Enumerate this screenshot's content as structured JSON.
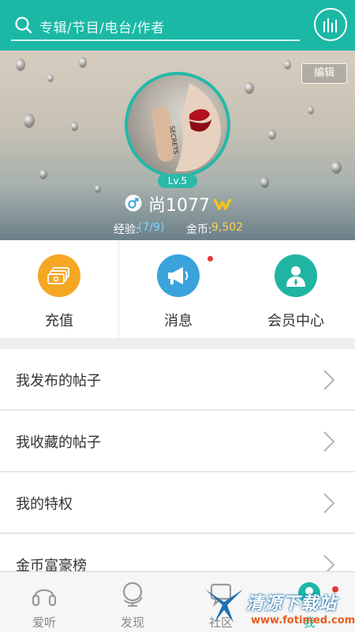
{
  "search": {
    "placeholder": "专辑/节目/电台/作者"
  },
  "profile": {
    "edit_label": "编辑",
    "level": "Lv.5",
    "username": "尚1077",
    "exp_label": "经验:",
    "exp_value": "(7/9)",
    "coin_label": "金币:",
    "coin_value": "9,502"
  },
  "quick_actions": [
    {
      "label": "充值",
      "icon": "wallet-icon",
      "color": "#f5a623"
    },
    {
      "label": "消息",
      "icon": "megaphone-icon",
      "color": "#3aa3dc",
      "has_dot": true
    },
    {
      "label": "会员中心",
      "icon": "member-person-icon",
      "color": "#20b5a3"
    }
  ],
  "menu": [
    {
      "label": "我发布的帖子"
    },
    {
      "label": "我收藏的帖子"
    },
    {
      "label": "我的特权"
    },
    {
      "label": "金币富豪榜"
    }
  ],
  "bottom_nav": [
    {
      "label": "爱听",
      "icon": "headphones-icon"
    },
    {
      "label": "发现",
      "icon": "globe-icon"
    },
    {
      "label": "社区",
      "icon": "community-icon"
    },
    {
      "label": "我",
      "icon": "user-icon",
      "active": true,
      "has_dot": true
    }
  ],
  "watermark": {
    "text": "清源下载站",
    "url": "www.fotimed.com"
  },
  "colors": {
    "accent": "#1bb8a6",
    "badge_red": "#e53935",
    "coin": "#ffd24a"
  }
}
